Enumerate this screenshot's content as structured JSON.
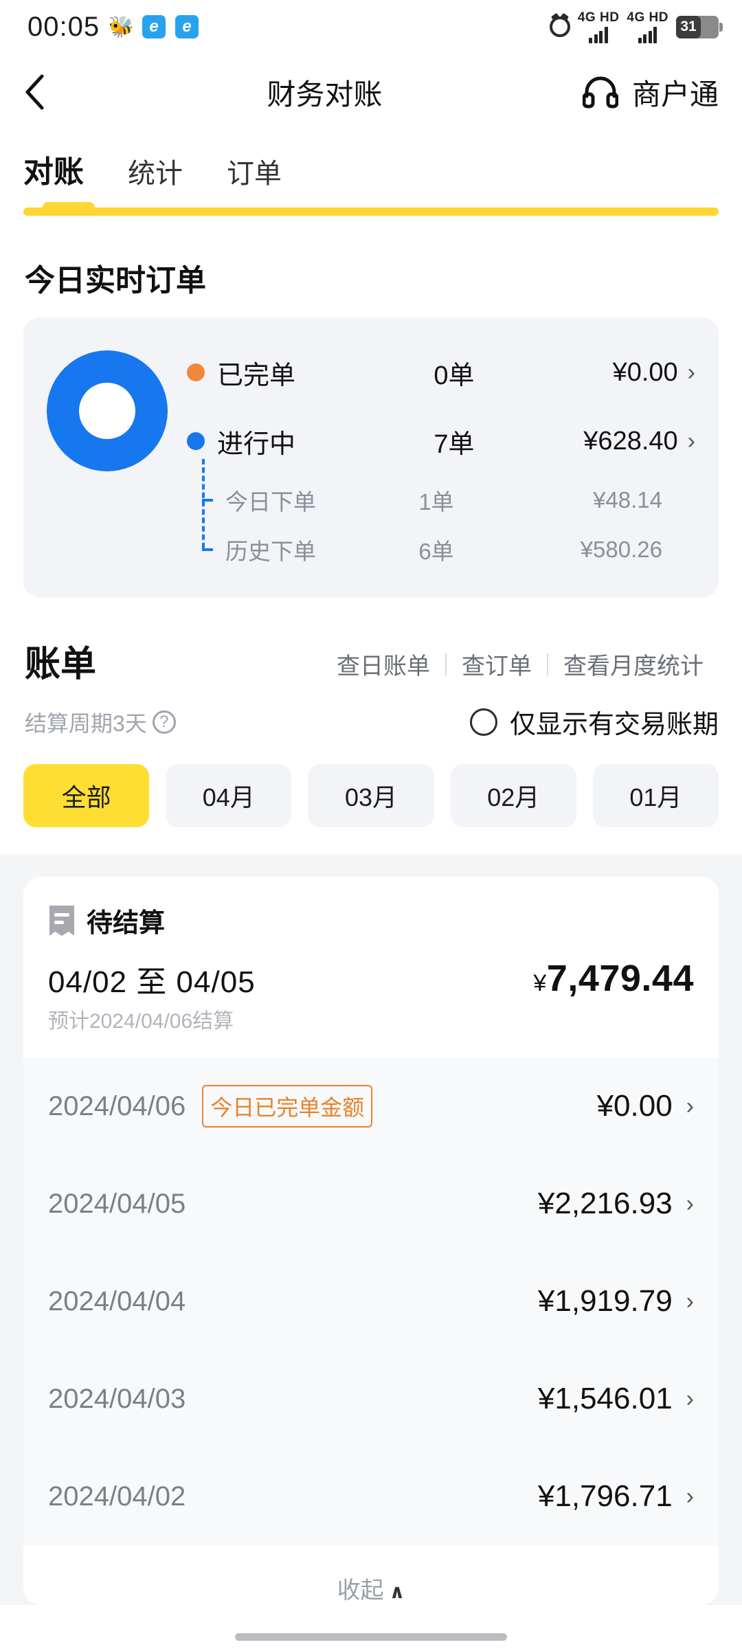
{
  "status_bar": {
    "time": "00:05",
    "app_icons": [
      "bee-icon",
      "browser-icon",
      "browser-icon"
    ],
    "alarm_icon": "alarm-icon",
    "sim1_network": "4G HD",
    "sim2_network": "4G HD",
    "battery_level": "31"
  },
  "header": {
    "back_icon": "chevron-left-icon",
    "title": "财务对账",
    "support_icon": "headset-icon",
    "right_label": "商户通"
  },
  "tabs": [
    {
      "label": "对账",
      "active": true
    },
    {
      "label": "统计",
      "active": false
    },
    {
      "label": "订单",
      "active": false
    }
  ],
  "realtime": {
    "section_title": "今日实时订单",
    "donut": {
      "completed_color": "#F0873C",
      "inprogress_color": "#1677EE",
      "completed_pct": 0,
      "inprogress_pct": 100
    },
    "rows": [
      {
        "dot": "done",
        "label": "已完单",
        "count": "0单",
        "amount": "¥0.00",
        "chevron": "›"
      },
      {
        "dot": "doing",
        "label": "进行中",
        "count": "7单",
        "amount": "¥628.40",
        "chevron": "›"
      }
    ],
    "sub_rows": [
      {
        "label": "今日下单",
        "count": "1单",
        "amount": "¥48.14"
      },
      {
        "label": "历史下单",
        "count": "6单",
        "amount": "¥580.26"
      }
    ]
  },
  "bill": {
    "title": "账单",
    "links": [
      "查日账单",
      "查订单",
      "查看月度统计"
    ],
    "cycle_text": "结算周期3天",
    "help_icon": "question-mark-icon",
    "filter_radio_icon": "radio-unchecked-icon",
    "filter_label": "仅显示有交易账期",
    "month_chips": [
      {
        "label": "全部",
        "active": true
      },
      {
        "label": "04月",
        "active": false
      },
      {
        "label": "03月",
        "active": false
      },
      {
        "label": "02月",
        "active": false
      },
      {
        "label": "01月",
        "active": false
      }
    ],
    "pending": {
      "icon": "receipt-icon",
      "label": "待结算",
      "range": "04/02 至 04/05",
      "estimate": "预计2024/04/06结算",
      "currency": "¥",
      "amount": "7,479.44"
    },
    "days": [
      {
        "date": "2024/04/06",
        "badge": "今日已完单金额",
        "amount": "¥0.00",
        "chevron": "›"
      },
      {
        "date": "2024/04/05",
        "badge": "",
        "amount": "¥2,216.93",
        "chevron": "›"
      },
      {
        "date": "2024/04/04",
        "badge": "",
        "amount": "¥1,919.79",
        "chevron": "›"
      },
      {
        "date": "2024/04/03",
        "badge": "",
        "amount": "¥1,546.01",
        "chevron": "›"
      },
      {
        "date": "2024/04/02",
        "badge": "",
        "amount": "¥1,796.71",
        "chevron": "›"
      }
    ],
    "collapse_label": "收起",
    "collapse_caret": "∧"
  },
  "theme": {
    "accent_yellow": "#FFDE33",
    "brand_blue": "#1677EE",
    "orange": "#F0873C",
    "badge_orange": "#E8822B"
  }
}
